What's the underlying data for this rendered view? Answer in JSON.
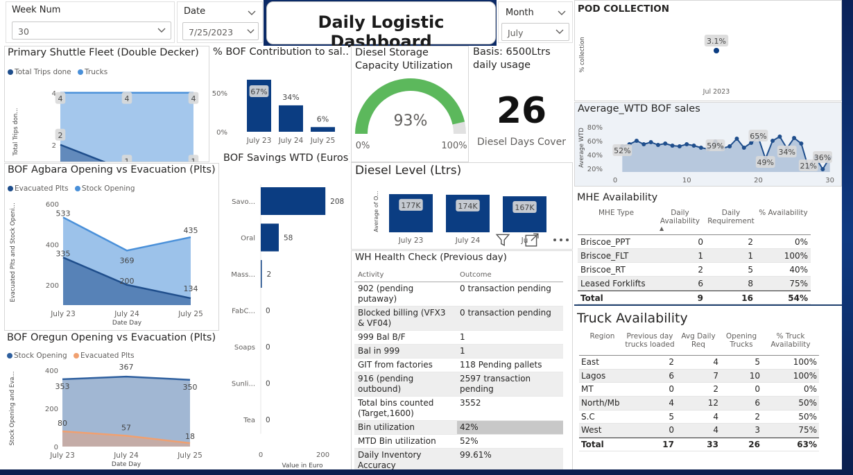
{
  "slicers": {
    "week": {
      "label": "Week Num",
      "value": "30"
    },
    "date": {
      "label": "Date",
      "value": "7/25/2023"
    },
    "month": {
      "label": "Month",
      "value": "July"
    }
  },
  "header": {
    "title": "Daily Logistic Dashboard"
  },
  "pod": {
    "title": "POD COLLECTION",
    "chart_data": {
      "type": "scatter",
      "title": "POD COLLECTION",
      "ylabel": "% collection",
      "x": [
        "Jul 2023"
      ],
      "values": [
        3.1
      ],
      "labels": [
        "3.1%"
      ]
    }
  },
  "shuttle": {
    "title": "Primary Shuttle Fleet (Double Decker)",
    "legend": [
      "Total Trips done",
      "Trucks"
    ],
    "chart_data": {
      "type": "area",
      "title": "Primary Shuttle Fleet (Double Decker)",
      "xlabel": "Date Day",
      "ylabel": "Total Trips don...",
      "categories": [
        "July 23",
        "July 24",
        "July 25"
      ],
      "yticks": [
        "2",
        "4"
      ],
      "ylim": [
        0.5,
        4.5
      ],
      "series": [
        {
          "name": "Total Trips done",
          "values": [
            2,
            1,
            1
          ],
          "color": "#1f4e8c",
          "labels": [
            "2",
            "1",
            "1"
          ]
        },
        {
          "name": "Trucks",
          "values": [
            4,
            4,
            4
          ],
          "color": "#4a90d9",
          "labels": [
            "4",
            "4",
            "4"
          ]
        }
      ]
    }
  },
  "bofcontrib": {
    "title": "% BOF Contribution to sal...",
    "chart_data": {
      "type": "bar",
      "title": "% BOF Contribution to sal...",
      "categories": [
        "July 23",
        "July 24",
        "July 25"
      ],
      "values": [
        67,
        34,
        6
      ],
      "labels": [
        "67%",
        "34%",
        "6%"
      ],
      "yticks": [
        "0%",
        "50%"
      ],
      "ylim": [
        0,
        75
      ]
    }
  },
  "diesel_storage": {
    "title_line1": "Diesel Storage",
    "title_line2": "Capacity Utilization",
    "chart_data": {
      "type": "gauge",
      "value": 93,
      "min_label": "0%",
      "max_label": "100%",
      "value_label": "93%"
    }
  },
  "diesel_cover": {
    "basis_line1": "Basis: 6500Ltrs",
    "basis_line2": "daily usage",
    "value": "26",
    "label": "Diesel Days Cover"
  },
  "agbara": {
    "title": "BOF Agbara Opening  vs Evacuation (Plts)",
    "legend": [
      "Evacuated Plts",
      "Stock Opening"
    ],
    "chart_data": {
      "type": "area",
      "title": "BOF Agbara Opening  vs Evacuation (Plts)",
      "xlabel": "Date Day",
      "ylabel": "Evacuated Plts and Stock Openi...",
      "categories": [
        "July 23",
        "July 24",
        "July 25"
      ],
      "yticks": [
        "200",
        "400",
        "600"
      ],
      "ylim": [
        100,
        620
      ],
      "series": [
        {
          "name": "Evacuated Plts",
          "values": [
            335,
            200,
            134
          ],
          "color": "#1f4e8c",
          "labels": [
            "335",
            "200",
            "134"
          ]
        },
        {
          "name": "Stock Opening",
          "values": [
            533,
            369,
            435
          ],
          "color": "#4a90d9",
          "labels": [
            "533",
            "369",
            "435"
          ]
        }
      ]
    }
  },
  "oregun": {
    "title": "BOF Oregun Opening vs Evacuation (Plts)",
    "legend": [
      "Stock Opening",
      "Evacuated Plts"
    ],
    "chart_data": {
      "type": "area",
      "title": "BOF Oregun Opening vs Evacuation (Plts)",
      "xlabel": "Date Day",
      "ylabel": "Stock Opening and Eva...",
      "categories": [
        "July 23",
        "July 24",
        "July 25"
      ],
      "yticks": [
        "0",
        "200",
        "400"
      ],
      "ylim": [
        0,
        400
      ],
      "series": [
        {
          "name": "Stock Opening",
          "values": [
            353,
            367,
            350
          ],
          "color": "#2e5f9e",
          "labels": [
            "353",
            "367",
            "350"
          ]
        },
        {
          "name": "Evacuated Plts",
          "values": [
            80,
            57,
            18
          ],
          "color": "#f0a070",
          "labels": [
            "80",
            "57",
            "18"
          ]
        }
      ]
    }
  },
  "savings": {
    "title": "BOF Savings WTD (Euros)",
    "chart_data": {
      "type": "bar",
      "orientation": "horizontal",
      "title": "BOF Savings WTD (Euros)",
      "xlabel": "Value in Euro",
      "xticks": [
        "0",
        "200"
      ],
      "xlim": [
        0,
        250
      ],
      "categories": [
        "Savo...",
        "Oral",
        "Mass...",
        "FabC...",
        "Soaps",
        "Sunli...",
        "Tea"
      ],
      "values": [
        208,
        58,
        2,
        0,
        0,
        0,
        0
      ],
      "labels": [
        "208",
        "58",
        "2",
        "0",
        "0",
        "0",
        "0"
      ]
    }
  },
  "diesel_level": {
    "title": "Diesel Level (Ltrs)",
    "chart_data": {
      "type": "bar",
      "title": "Diesel Level (Ltrs)",
      "ylabel": "Average of O...",
      "categories": [
        "July 23",
        "July 24",
        "Ju"
      ],
      "values": [
        177,
        174,
        167
      ],
      "labels": [
        "177K",
        "174K",
        "167K"
      ],
      "ylim": [
        0,
        180
      ]
    }
  },
  "avg_wtd": {
    "title": "Average_WTD BOF sales",
    "chart_data": {
      "type": "line",
      "title": "Average_WTD BOF sales",
      "ylabel": "Average WTD",
      "xticks": [
        "0",
        "10",
        "20",
        "30"
      ],
      "xlim": [
        0,
        31
      ],
      "yticks": [
        "20%",
        "40%",
        "60%",
        "80%"
      ],
      "ylim": [
        15,
        85
      ],
      "x": [
        1,
        2,
        3,
        4,
        5,
        6,
        7,
        8,
        9,
        10,
        11,
        12,
        13,
        14,
        15,
        16,
        17,
        18,
        19,
        20,
        21,
        22,
        23,
        24,
        25,
        26,
        27,
        28,
        29,
        30
      ],
      "values": [
        52,
        55,
        60,
        55,
        58,
        54,
        56,
        53,
        52,
        55,
        53,
        50,
        48,
        59,
        49,
        52,
        63,
        50,
        57,
        65,
        34,
        60,
        66,
        49,
        64,
        56,
        21,
        36,
        19,
        36
      ],
      "labels": [
        "52%",
        "59%",
        "65%",
        "49%",
        "34%",
        "21%",
        "36%"
      ]
    }
  },
  "mhe": {
    "title": "MHE Availability",
    "headers": [
      "MHE Type",
      "Daily Availability",
      "Daily Requirement",
      "% Availability"
    ],
    "rows": [
      [
        "Briscoe_PPT",
        "0",
        "2",
        "0%"
      ],
      [
        "Briscoe_FLT",
        "1",
        "1",
        "100%"
      ],
      [
        "Briscoe_RT",
        "2",
        "5",
        "40%"
      ],
      [
        "Leased Forklifts",
        "6",
        "8",
        "75%"
      ]
    ],
    "total": [
      "Total",
      "9",
      "16",
      "54%"
    ]
  },
  "wh": {
    "title": "WH Health Check (Previous day)",
    "headers": [
      "Activity",
      "Outcome"
    ],
    "rows": [
      [
        "902 (pending putaway)",
        "0 transaction pending"
      ],
      [
        "Blocked billing (VFX3 & VF04)",
        "0 transaction pending"
      ],
      [
        "999 Bal B/F",
        "1"
      ],
      [
        "Bal in 999",
        "1"
      ],
      [
        "GIT from factories",
        "118 Pending pallets"
      ],
      [
        "916 (pending outbound)",
        "2597 transaction pending"
      ],
      [
        "Total bins counted (Target,1600)",
        "3552"
      ],
      [
        "Bin utilization",
        "42%"
      ],
      [
        "MTD Bin utilization",
        "52%"
      ],
      [
        "Daily Inventory Accuracy",
        "99.61%"
      ]
    ]
  },
  "truck": {
    "title": "Truck Availability",
    "headers": [
      "Region",
      "Previous day trucks loaded",
      "Avg Daily Req",
      "Opening Trucks",
      "% Truck Availability"
    ],
    "rows": [
      [
        "East",
        "2",
        "4",
        "5",
        "100%"
      ],
      [
        "Lagos",
        "6",
        "7",
        "10",
        "100%"
      ],
      [
        "MT",
        "0",
        "2",
        "0",
        "0%"
      ],
      [
        "North/Mb",
        "4",
        "12",
        "6",
        "50%"
      ],
      [
        "S.C",
        "5",
        "4",
        "2",
        "50%"
      ],
      [
        "West",
        "0",
        "4",
        "3",
        "75%"
      ]
    ],
    "total": [
      "Total",
      "17",
      "33",
      "26",
      "63%"
    ]
  },
  "colors": {
    "navy": "#0b3d82",
    "blue": "#4a90d9",
    "green": "#5cb85c",
    "orange": "#f0a070"
  }
}
